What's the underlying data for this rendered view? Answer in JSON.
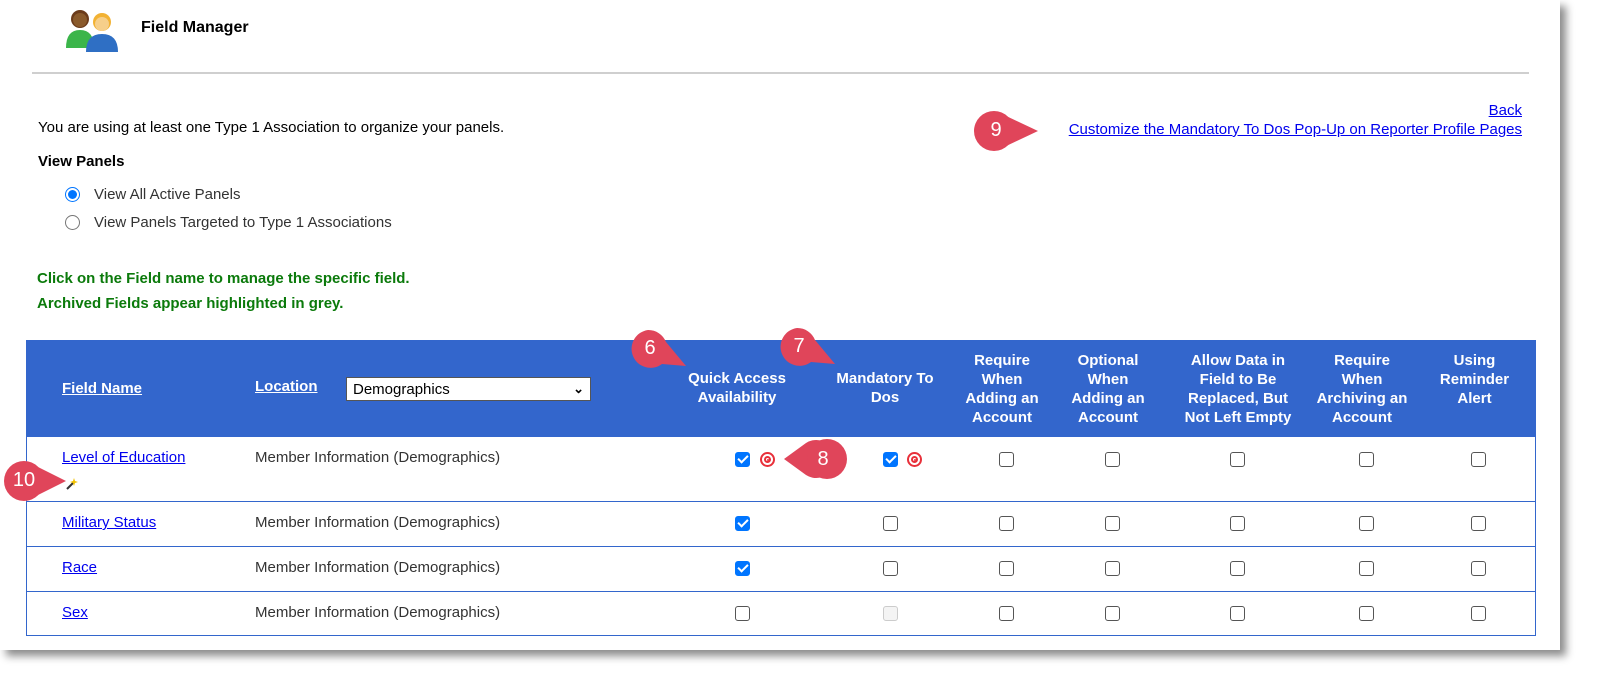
{
  "header": {
    "title": "Field Manager",
    "icon": "users-icon"
  },
  "notice": "You are using at least one Type 1 Association to organize your panels.",
  "links": {
    "back": "Back",
    "customize": "Customize the Mandatory To Dos Pop-Up on Reporter Profile Pages"
  },
  "view_panels": {
    "title": "View Panels",
    "options": [
      {
        "label": "View All Active Panels",
        "selected": true
      },
      {
        "label": "View Panels Targeted to Type 1 Associations",
        "selected": false
      }
    ]
  },
  "notes": [
    "Click on the Field name to manage the specific field.",
    "Archived Fields appear highlighted in grey."
  ],
  "table": {
    "columns": {
      "field_name": "Field Name",
      "location": "Location",
      "location_filter": "Demographics",
      "quick_access": [
        "Quick Access",
        "Availability"
      ],
      "mandatory": [
        "Mandatory To",
        "Dos"
      ],
      "require_adding": [
        "Require",
        "When",
        "Adding an",
        "Account"
      ],
      "optional_adding": [
        "Optional",
        "When",
        "Adding an",
        "Account"
      ],
      "allow_replace": [
        "Allow Data in",
        "Field to Be",
        "Replaced, But",
        "Not Left Empty"
      ],
      "require_archiving": [
        "Require",
        "When",
        "Archiving an",
        "Account"
      ],
      "reminder": [
        "Using",
        "Reminder",
        "Alert"
      ]
    },
    "rows": [
      {
        "field": "Level of Education",
        "location": "Member Information (Demographics)",
        "quick_access": true,
        "mandatory": true,
        "mandatory_disabled": false,
        "has_wand": true,
        "has_targets": true
      },
      {
        "field": "Military Status",
        "location": "Member Information (Demographics)",
        "quick_access": true,
        "mandatory": false,
        "mandatory_disabled": false,
        "has_wand": false,
        "has_targets": false
      },
      {
        "field": "Race",
        "location": "Member Information (Demographics)",
        "quick_access": true,
        "mandatory": false,
        "mandatory_disabled": false,
        "has_wand": false,
        "has_targets": false
      },
      {
        "field": "Sex",
        "location": "Member Information (Demographics)",
        "quick_access": false,
        "mandatory": false,
        "mandatory_disabled": true,
        "has_wand": false,
        "has_targets": false
      }
    ]
  },
  "callouts": {
    "c6": "6",
    "c7": "7",
    "c8": "8",
    "c9": "9",
    "c10": "10",
    "color": "#e0455a"
  }
}
